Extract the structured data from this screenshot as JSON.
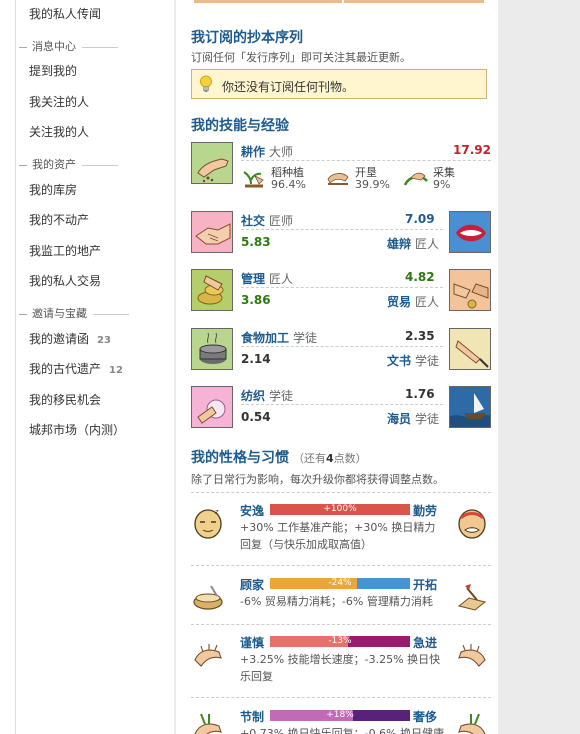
{
  "sidebar": {
    "top_link": "我的私人传闻",
    "groups": [
      {
        "heading": "消息中心",
        "items": [
          {
            "label": "提到我的"
          },
          {
            "label": "我关注的人"
          },
          {
            "label": "关注我的人"
          }
        ]
      },
      {
        "heading": "我的资产",
        "items": [
          {
            "label": "我的库房"
          },
          {
            "label": "我的不动产"
          },
          {
            "label": "我监工的地产"
          },
          {
            "label": "我的私人交易"
          }
        ]
      },
      {
        "heading": "邀请与宝藏",
        "items": [
          {
            "label": "我的邀请函",
            "count": "23"
          },
          {
            "label": "我的古代遗产",
            "count": "12"
          },
          {
            "label": "我的移民机会"
          },
          {
            "label": "城邦市场（内测）"
          }
        ]
      }
    ]
  },
  "subscriptions": {
    "title": "我订阅的抄本序列",
    "description": "订阅任何「发行序列」即可关注其最近更新。",
    "notice": "你还没有订阅任何刊物。"
  },
  "skills": {
    "title": "我的技能与经验",
    "farming": {
      "name": "耕作",
      "rank": "大师",
      "value": "17.92",
      "subskills": [
        {
          "name": "稻种植",
          "percent": "96.4%",
          "icon": "sprout-icon"
        },
        {
          "name": "开垦",
          "percent": "39.9%",
          "icon": "plow-icon"
        },
        {
          "name": "采集",
          "percent": "9%",
          "icon": "gather-icon"
        }
      ]
    },
    "pairs": [
      {
        "name": "社交",
        "rank": "匠师",
        "value": "7.09",
        "partner_value": "5.83",
        "partner_name": "雄辩",
        "partner_rank": "匠人",
        "icon": "handshake-icon",
        "partner_icon": "mouth-icon"
      },
      {
        "name": "管理",
        "rank": "匠人",
        "value": "4.82",
        "partner_value": "3.86",
        "partner_name": "贸易",
        "partner_rank": "匠人",
        "icon": "coins-icon",
        "partner_icon": "trade-hands-icon"
      },
      {
        "name": "食物加工",
        "rank": "学徒",
        "value": "2.35",
        "partner_value": "2.14",
        "partner_name": "文书",
        "partner_rank": "学徒",
        "icon": "cooking-pot-icon",
        "partner_icon": "writing-hand-icon"
      },
      {
        "name": "纺织",
        "rank": "学徒",
        "value": "1.76",
        "partner_value": "0.54",
        "partner_name": "海员",
        "partner_rank": "学徒",
        "icon": "spinning-icon",
        "partner_icon": "ship-icon"
      }
    ]
  },
  "traits": {
    "title": "我的性格与习惯",
    "points_prefix": "（还有",
    "points": "4",
    "points_suffix": "点数）",
    "description": "除了日常行为影响，每次升级你都将获得调整点数。",
    "items": [
      {
        "left": "安逸",
        "right": "勤劳",
        "bar_label": "+100%",
        "left_share": 1.0,
        "left_color": "#d9554c",
        "right_color": "#d9554c",
        "effect": "+30% 工作基准产能；+30% 换日精力回复（与快乐加成取高值）",
        "left_icon": "sleepy-face-icon",
        "right_icon": "sweaty-face-icon"
      },
      {
        "left": "顾家",
        "right": "开拓",
        "bar_label": "-24%",
        "left_share": 0.62,
        "left_color": "#eba53a",
        "right_color": "#4495d6",
        "effect": "-6% 贸易精力消耗；-6% 管理精力消耗",
        "left_icon": "bowl-icon",
        "right_icon": "map-icon"
      },
      {
        "left": "谨慎",
        "right": "急进",
        "bar_label": "-13%",
        "left_share": 0.56,
        "left_color": "#e8706b",
        "right_color": "#9a1a6f",
        "effect": "+3.25% 技能增长速度；-3.25% 换日快乐回复",
        "left_icon": "cautious-hand-icon",
        "right_icon": "reaching-hand-icon"
      },
      {
        "left": "节制",
        "right": "奢侈",
        "bar_label": "+18%",
        "left_share": 0.59,
        "left_color": "#c06ab8",
        "right_color": "#5a2178",
        "effect": "+0.73% 换日快乐回复；-0.6% 换日健康回",
        "left_icon": "restrained-hand-icon",
        "right_icon": "lavish-hand-icon"
      }
    ]
  }
}
